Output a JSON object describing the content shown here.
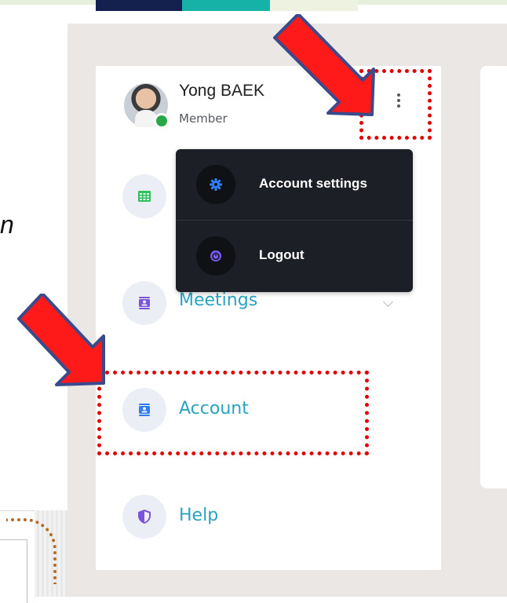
{
  "slide": {
    "fragment_text": "n"
  },
  "user": {
    "name": "Yong BAEK",
    "role": "Member",
    "status_color": "#28a745"
  },
  "menu_button": {
    "icon": "kebab-menu-icon"
  },
  "dropdown": {
    "items": [
      {
        "label": "Account settings",
        "icon": "gear-icon",
        "icon_color": "#2f7cf6"
      },
      {
        "label": "Logout",
        "icon": "power-icon",
        "icon_color": "#7d5cff"
      }
    ]
  },
  "nav": {
    "items": [
      {
        "label": "",
        "icon": "calendar-grid-icon",
        "icon_color": "#2fbf5a"
      },
      {
        "label": "Meetings",
        "icon": "contact-card-icon",
        "icon_color": "#7b55d9",
        "expandable": true
      },
      {
        "label": "Account",
        "icon": "contact-card-icon",
        "icon_color": "#2f7cf6"
      },
      {
        "label": "Help",
        "icon": "shield-icon",
        "icon_color": "#7b55d9"
      }
    ]
  },
  "colors": {
    "accent": "#2aa3c3",
    "annotation_red": "#e00000",
    "dropdown_bg": "#1c1f25",
    "app_bg": "#ebe7e4"
  }
}
